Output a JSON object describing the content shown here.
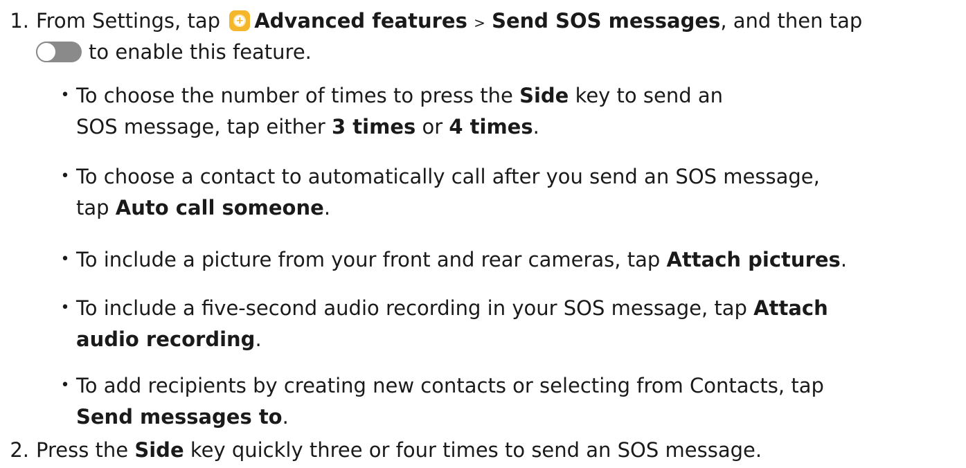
{
  "step1": {
    "number": "1.",
    "l1_a": "From Settings, tap",
    "l1_b": "Advanced features",
    "l1_c": ">",
    "l1_d": "Send SOS messages",
    "l1_e": ", and then tap",
    "l2": "to enable this feature.",
    "icon": "settings-gear-icon",
    "toggle_icon": "toggle-switch-icon",
    "toggle_state": "off"
  },
  "bullets": {
    "b1_l1_a": "To choose the number of times to press the",
    "b1_l1_b": "Side",
    "b1_l1_c": "key to send an",
    "b1_l2_a": "SOS message, tap either",
    "b1_l2_b": "3 times",
    "b1_l2_c": "or",
    "b1_l2_d": "4 times",
    "b1_l2_e": ".",
    "b2_l1": "To choose a contact to automatically call after you send an SOS message,",
    "b2_l2_a": "tap",
    "b2_l2_b": "Auto call someone",
    "b2_l2_c": ".",
    "b3_a": "To include a picture from your front and rear cameras, tap",
    "b3_b": "Attach pictures",
    "b3_c": ".",
    "b4_l1_a": "To include a five-second audio recording in your SOS message, tap",
    "b4_l1_b": "Attach",
    "b4_l2_a": "audio recording",
    "b4_l2_b": ".",
    "b5_l1": "To add recipients by creating new contacts or selecting from Contacts, tap",
    "b5_l2_a": "Send messages to",
    "b5_l2_b": "."
  },
  "step2": {
    "number": "2.",
    "a": "Press the",
    "b": "Side",
    "c": "key quickly three or four times to send an SOS message."
  }
}
